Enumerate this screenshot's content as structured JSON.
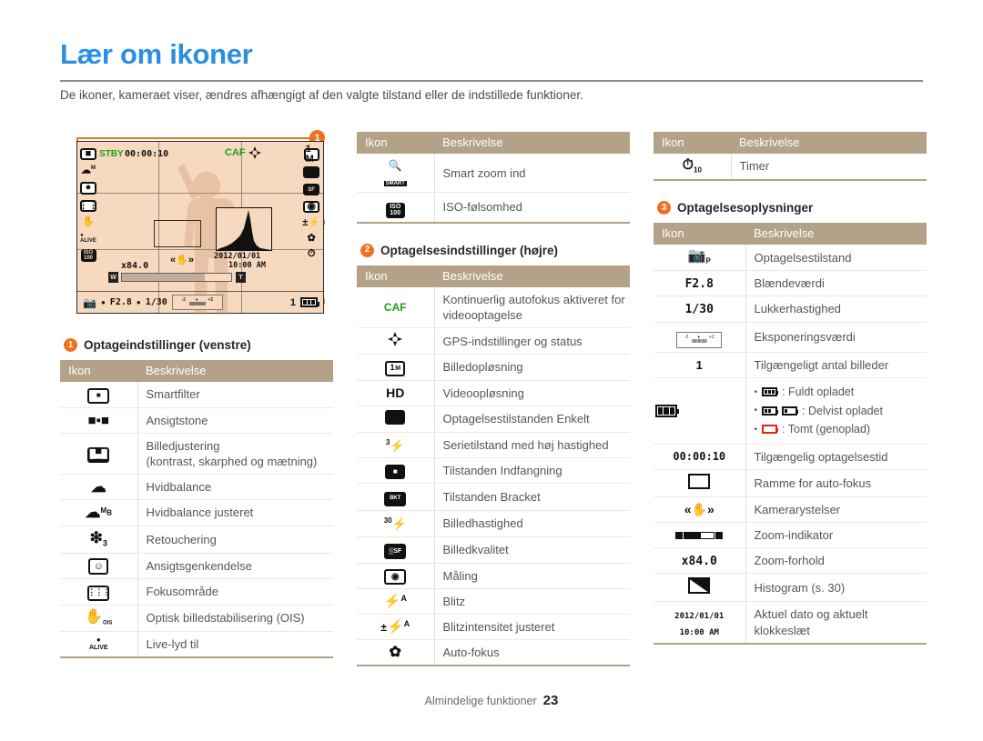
{
  "page": {
    "title": "Lær om ikoner",
    "intro": "De ikoner, kameraet viser, ændres afhængigt af den valgte tilstand eller de indstillede funktioner.",
    "footer_label": "Almindelige funktioner",
    "page_number": "23",
    "accent_blue": "#2a8fe0",
    "accent_orange": "#f07020",
    "table_header_bg": "#b3a287",
    "lcd_bg": "#f7d9c0"
  },
  "lcd": {
    "stby_label": "STBY",
    "record_time": "00:00:10",
    "caf_label": "CAF",
    "zoom_ratio": "x84.0",
    "zoom_wide_label": "W",
    "zoom_tele_label": "T",
    "date": "2012/01/01",
    "time": "10:00 AM",
    "aperture": "F2.8",
    "shutter": "1/30",
    "shots_left": "1",
    "exposure_left": "-2",
    "exposure_center": "0",
    "exposure_right": "+2",
    "callouts": [
      {
        "number": "1",
        "region": "left-settings"
      },
      {
        "number": "2",
        "region": "right-settings"
      },
      {
        "number": "3",
        "region": "shooting-info"
      }
    ],
    "left_rail_icons": [
      "smart-filter-icon",
      "white-balance-adjusted-icon",
      "face-detection-icon",
      "focus-area-icon",
      "ois-icon",
      "live-sound-icon",
      "iso-icon"
    ],
    "right_rail_icons": [
      "photo-resolution-icon",
      "single-shot-icon",
      "photo-quality-icon",
      "metering-icon",
      "flash-intensity-icon",
      "auto-focus-icon",
      "timer-icon"
    ]
  },
  "columns": {
    "left": {
      "section": {
        "number": "1",
        "heading": "Optageindstillinger (venstre)"
      },
      "table": {
        "headers": [
          "Ikon",
          "Beskrivelse"
        ],
        "rows": [
          {
            "icon": "smart-filter-icon",
            "desc": "Smartfilter"
          },
          {
            "icon": "face-tone-icon",
            "desc": "Ansigtstone"
          },
          {
            "icon": "image-adjust-icon",
            "desc": "Billedjustering\n(kontrast, skarphed og mætning)"
          },
          {
            "icon": "white-balance-icon",
            "desc": "Hvidbalance"
          },
          {
            "icon": "white-balance-adjusted-icon",
            "desc": "Hvidbalance justeret"
          },
          {
            "icon": "retouch-icon",
            "desc": "Retouchering"
          },
          {
            "icon": "face-detection-icon",
            "desc": "Ansigtsgenkendelse"
          },
          {
            "icon": "focus-area-icon",
            "desc": "Fokusområde"
          },
          {
            "icon": "ois-icon",
            "desc": "Optisk billedstabilisering (OIS)"
          },
          {
            "icon": "live-sound-icon",
            "desc": "Live-lyd til"
          }
        ]
      }
    },
    "middle": {
      "table_top": {
        "headers": [
          "Ikon",
          "Beskrivelse"
        ],
        "rows": [
          {
            "icon": "smart-zoom-icon",
            "desc": "Smart zoom ind"
          },
          {
            "icon": "iso-icon",
            "desc": "ISO-følsomhed"
          }
        ]
      },
      "section": {
        "number": "2",
        "heading": "Optagelsesindstillinger (højre)"
      },
      "table": {
        "headers": [
          "Ikon",
          "Beskrivelse"
        ],
        "rows": [
          {
            "icon": "caf-icon",
            "desc": "Kontinuerlig autofokus aktiveret for videooptagelse"
          },
          {
            "icon": "gps-icon",
            "desc": "GPS-indstillinger og status"
          },
          {
            "icon": "photo-resolution-icon",
            "desc": "Billedopløsning"
          },
          {
            "icon": "video-resolution-icon",
            "desc": "Videoopløsning"
          },
          {
            "icon": "single-shot-icon",
            "desc": "Optagelsestilstanden Enkelt"
          },
          {
            "icon": "burst-icon",
            "desc": "Serietilstand med høj hastighed"
          },
          {
            "icon": "capture-icon",
            "desc": "Tilstanden Indfangning"
          },
          {
            "icon": "bracket-icon",
            "desc": "Tilstanden Bracket"
          },
          {
            "icon": "frame-rate-icon",
            "desc": "Billedhastighed"
          },
          {
            "icon": "photo-quality-icon",
            "desc": "Billedkvalitet"
          },
          {
            "icon": "metering-icon",
            "desc": "Måling"
          },
          {
            "icon": "flash-icon",
            "desc": "Blitz"
          },
          {
            "icon": "flash-intensity-icon",
            "desc": "Blitzintensitet justeret"
          },
          {
            "icon": "auto-focus-icon",
            "desc": "Auto-fokus"
          }
        ]
      }
    },
    "right": {
      "table_top": {
        "headers": [
          "Ikon",
          "Beskrivelse"
        ],
        "rows": [
          {
            "icon": "timer-icon",
            "desc": "Timer"
          }
        ]
      },
      "section": {
        "number": "3",
        "heading": "Optagelsesoplysninger"
      },
      "table": {
        "headers": [
          "Ikon",
          "Beskrivelse"
        ],
        "rows": [
          {
            "icon": "shooting-mode-icon",
            "desc": "Optagelsestilstand",
            "value": ""
          },
          {
            "icon": "aperture-value",
            "desc": "Blændeværdi",
            "value": "F2.8"
          },
          {
            "icon": "shutter-value",
            "desc": "Lukkerhastighed",
            "value": "1/30"
          },
          {
            "icon": "exposure-value-icon",
            "desc": "Eksponeringsværdi",
            "value": ""
          },
          {
            "icon": "shots-available",
            "desc": "Tilgængeligt antal billeder",
            "value": "1"
          },
          {
            "icon": "battery-icon",
            "desc": "BATTERY_LIST",
            "value": ""
          },
          {
            "icon": "recording-time",
            "desc": "Tilgængelig optagelsestid",
            "value": "00:00:10"
          },
          {
            "icon": "af-frame-icon",
            "desc": "Ramme for auto-fokus",
            "value": ""
          },
          {
            "icon": "camera-shake-icon",
            "desc": "Kamerarystelser",
            "value": ""
          },
          {
            "icon": "zoom-indicator-icon",
            "desc": "Zoom-indikator",
            "value": ""
          },
          {
            "icon": "zoom-ratio-value",
            "desc": "Zoom-forhold",
            "value": "x84.0"
          },
          {
            "icon": "histogram-icon",
            "desc": "Histogram (s. 30)",
            "value": ""
          },
          {
            "icon": "datetime-value",
            "desc": "Aktuel dato og aktuelt klokkeslæt",
            "value": "2012/01/01 10:00 AM"
          }
        ]
      },
      "battery_states": [
        {
          "state": "full",
          "label": ": Fuldt opladet"
        },
        {
          "state": "partial",
          "label": ": Delvist opladet"
        },
        {
          "state": "empty",
          "label": ": Tomt (genoplad)"
        }
      ]
    }
  }
}
